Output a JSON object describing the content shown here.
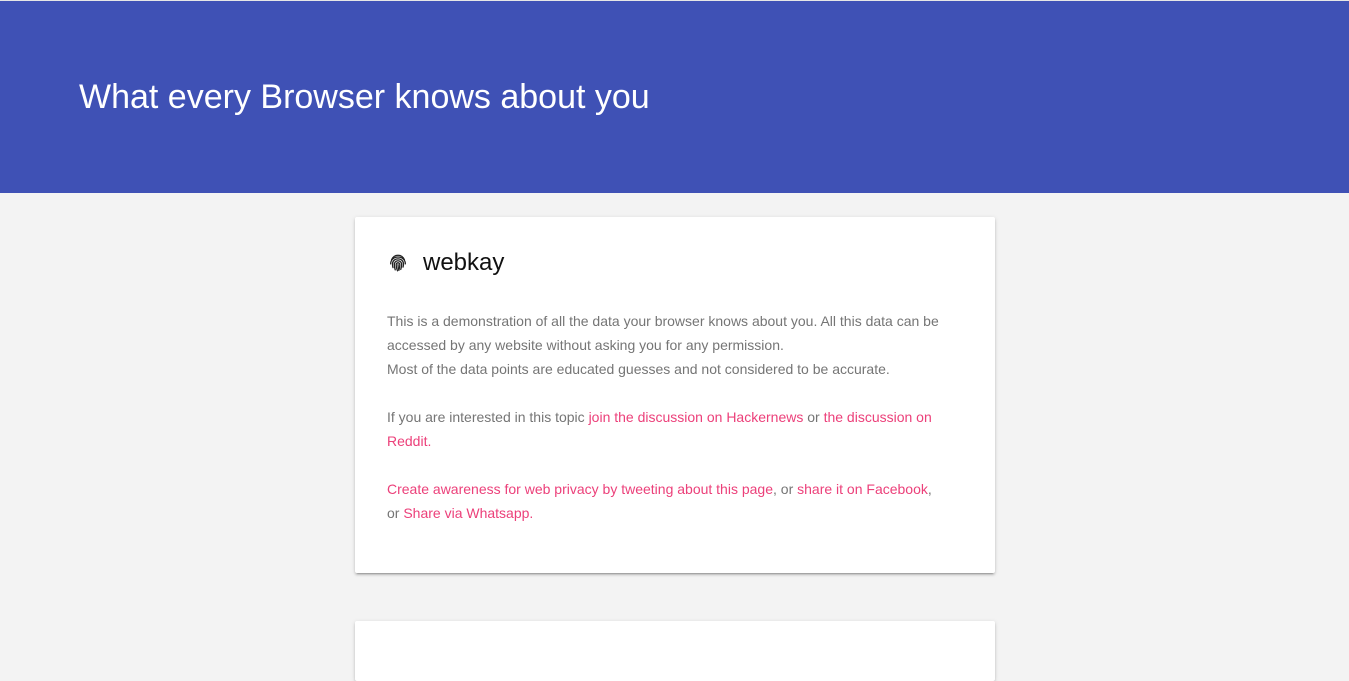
{
  "header": {
    "title": "What every Browser knows about you",
    "background": "#3f51b5"
  },
  "intro_card": {
    "brand_icon": "fingerprint-icon",
    "brand_name": "webkay",
    "paragraph1": {
      "line1": "This is a demonstration of all the data your browser knows about you. All this data can be accessed by any website without asking you for any permission.",
      "line2": "Most of the data points are educated guesses and not considered to be accurate."
    },
    "paragraph2": {
      "prefix": "If you are interested in this topic ",
      "link1": "join the discussion on Hackernews",
      "middle": " or ",
      "link2": "the discussion on Reddit",
      "suffix": "."
    },
    "paragraph3": {
      "link1": "Create awareness for web privacy by tweeting about this page",
      "sep1": ", or ",
      "link2": "share it on Facebook",
      "sep2": ", or ",
      "link3": "Share via Whatsapp",
      "suffix": "."
    }
  },
  "colors": {
    "link": "#ec407a",
    "body_text": "#757575",
    "page_background": "#f3f3f3"
  }
}
